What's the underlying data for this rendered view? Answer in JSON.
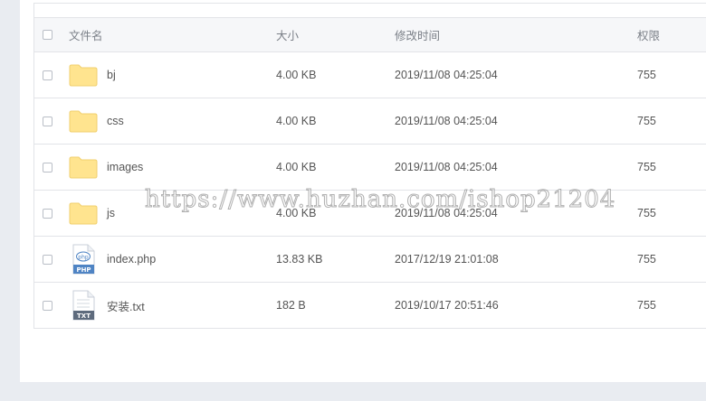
{
  "table": {
    "headers": {
      "name": "文件名",
      "size": "大小",
      "modified": "修改时间",
      "permissions": "权限"
    },
    "rows": [
      {
        "name": "bj",
        "type": "folder",
        "size": "4.00 KB",
        "modified": "2019/11/08 04:25:04",
        "perm": "755"
      },
      {
        "name": "css",
        "type": "folder",
        "size": "4.00 KB",
        "modified": "2019/11/08 04:25:04",
        "perm": "755"
      },
      {
        "name": "images",
        "type": "folder",
        "size": "4.00 KB",
        "modified": "2019/11/08 04:25:04",
        "perm": "755"
      },
      {
        "name": "js",
        "type": "folder",
        "size": "4.00 KB",
        "modified": "2019/11/08 04:25:04",
        "perm": "755"
      },
      {
        "name": "index.php",
        "type": "php",
        "size": "13.83 KB",
        "modified": "2017/12/19 21:01:08",
        "perm": "755"
      },
      {
        "name": "安装.txt",
        "type": "txt",
        "size": "182 B",
        "modified": "2019/10/17 20:51:46",
        "perm": "755"
      }
    ]
  },
  "icons": {
    "folder": "folder-icon",
    "php": "php-file-icon",
    "txt": "txt-file-icon",
    "php_badge": "PHP",
    "php_glyph": "php",
    "txt_badge": "TXT"
  },
  "colors": {
    "folder": "#ffe48f",
    "folder_tab": "#f6d36f",
    "php_badge": "#4f84c4",
    "txt_badge": "#5e6b7d",
    "border": "#e2e4e8",
    "header_bg": "#f6f7f9"
  },
  "watermark": "https://www.huzhan.com/ishop21204"
}
